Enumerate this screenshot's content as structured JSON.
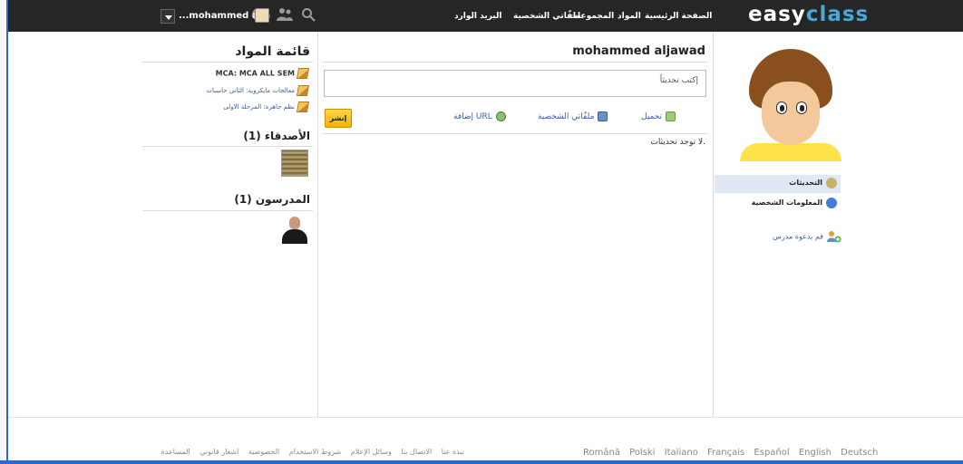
{
  "topbar": {
    "logo_part1": "easy",
    "logo_part2": "class",
    "nav": [
      "الصفحة الرئيسية",
      "المواد",
      "المجموعات",
      "ملفّاتي الشخصية",
      "البريد الوارد"
    ],
    "user_name": "...mohammed alja"
  },
  "left": {
    "courses_title": "قائمة المواد",
    "courses": [
      "MCA: MCA ALL SEM",
      "معالجات مايكروية: الثاني حاسبات",
      "نظم جاهزة: المرحلة الاولى"
    ],
    "friends_title": "الأصدقاء (1)",
    "teachers_title": "المدرسون (1)"
  },
  "main": {
    "profile_name": "mohammed aljawad",
    "update_placeholder": "إكتب تحديثاً",
    "post_button": "إنشر",
    "actions": [
      "تحميل",
      "ملفّاتي الشخصية",
      "إضافة URL"
    ],
    "no_updates": "لا توجد تحديثات."
  },
  "sidebar": {
    "items": [
      "التحديثات",
      "المعلومات الشخصية"
    ],
    "invite_teacher": "قم بدعوة مدرس"
  },
  "footer": {
    "links": [
      "نبذة عنا",
      "الاتصال بنا",
      "وسائل الإعلام",
      "شروط الاستخدام",
      "الخصوصية",
      "اشعار قانوني",
      "المساعدة"
    ],
    "languages": [
      "Română",
      "Polski",
      "Italiano",
      "Français",
      "Español",
      "English",
      "Deutsch"
    ]
  },
  "colors": {
    "topbar": "#262626",
    "logo_accent": "#4aa8d8",
    "link": "#3b5fa5",
    "post_button": "#f4b400",
    "active_item": "#dfe8f4"
  },
  "icons": [
    "chevron-down-icon",
    "user-avatar-icon",
    "alert-icon",
    "people-icon",
    "search-icon",
    "pencil-icon",
    "upload-icon",
    "profile-files-icon",
    "link-icon",
    "updates-icon",
    "info-icon",
    "invite-teacher-icon"
  ]
}
